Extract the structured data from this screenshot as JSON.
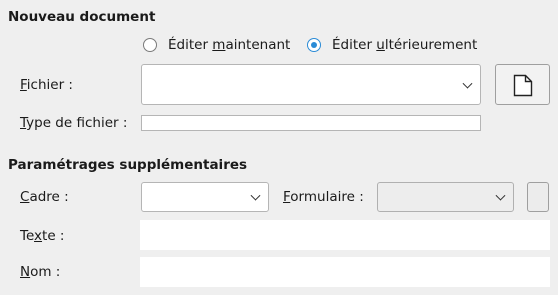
{
  "new_document": {
    "title": "Nouveau document",
    "edit_now": {
      "pre": "Éditer ",
      "u": "m",
      "post": "aintenant",
      "checked": false
    },
    "edit_later": {
      "pre": "Éditer ",
      "u": "u",
      "post": "ltérieurement",
      "checked": true
    },
    "file": {
      "u": "F",
      "rest": "ichier :",
      "value": ""
    },
    "file_type": {
      "u": "T",
      "rest": "ype de fichier :",
      "value": ""
    }
  },
  "additional": {
    "title": "Paramétrages supplémentaires",
    "frame": {
      "u": "C",
      "rest": "adre :",
      "value": ""
    },
    "form": {
      "u": "F",
      "rest": "ormulaire :",
      "value": ""
    },
    "text": {
      "pre": "Te",
      "u": "x",
      "post": "te :",
      "value": ""
    },
    "name": {
      "u": "N",
      "rest": "om :",
      "value": ""
    }
  },
  "icons": {
    "new_file": "document-icon",
    "dropdown": "chevron-down-icon"
  }
}
